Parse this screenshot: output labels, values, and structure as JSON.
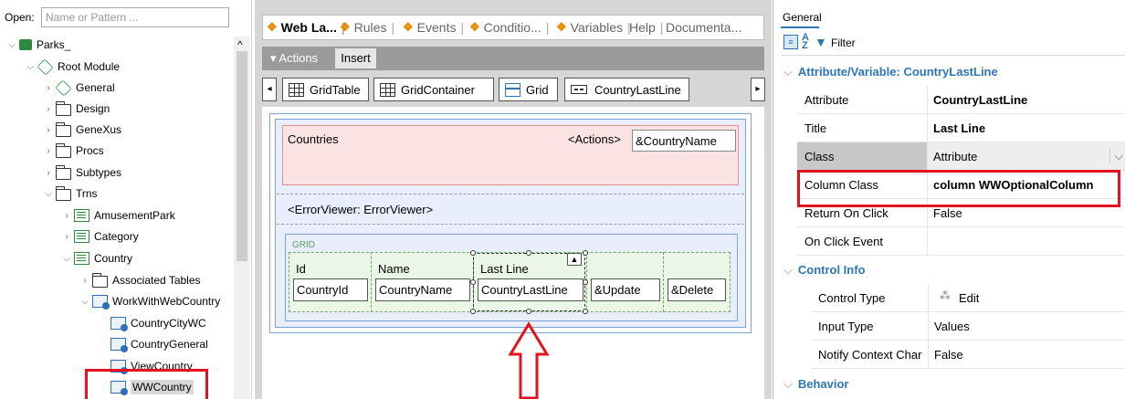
{
  "left_panel": {
    "open_label": "Open:",
    "open_placeholder": "Name or Pattern ...",
    "tree": [
      {
        "label": "Parks_",
        "icon": "kb-icon",
        "level": 0
      },
      {
        "label": "Root Module",
        "icon": "module-icon",
        "level": 1
      },
      {
        "label": "General",
        "icon": "module-icon",
        "level": 2
      },
      {
        "label": "Design",
        "icon": "folder-icon",
        "level": 2
      },
      {
        "label": "GeneXus",
        "icon": "folder-icon",
        "level": 2
      },
      {
        "label": "Procs",
        "icon": "folder-icon",
        "level": 2
      },
      {
        "label": "Subtypes",
        "icon": "folder-icon",
        "level": 2
      },
      {
        "label": "Trns",
        "icon": "folder-icon",
        "level": 2
      },
      {
        "label": "AmusementPark",
        "icon": "transaction-icon",
        "level": 3
      },
      {
        "label": "Category",
        "icon": "transaction-icon",
        "level": 3
      },
      {
        "label": "Country",
        "icon": "transaction-icon",
        "level": 3
      },
      {
        "label": "Associated Tables",
        "icon": "folder-icon",
        "level": 4
      },
      {
        "label": "WorkWithWebCountry",
        "icon": "workwith-icon",
        "level": 4
      },
      {
        "label": "CountryCityWC",
        "icon": "webcomponent-icon",
        "level": 5
      },
      {
        "label": "CountryGeneral",
        "icon": "webcomponent-icon",
        "level": 5
      },
      {
        "label": "ViewCountry",
        "icon": "webpanel-icon",
        "level": 5
      },
      {
        "label": "WWCountry",
        "icon": "webpanel-icon",
        "level": 5
      }
    ]
  },
  "editor": {
    "tabs": [
      "Web La...",
      "Rules",
      "Events",
      "Conditio...",
      "Variables",
      "Help",
      "Documenta..."
    ],
    "actions_label": "Actions",
    "insert_label": "Insert",
    "breadcrumbs": [
      "GridTable",
      "GridContainer",
      "Grid",
      "CountryLastLine"
    ],
    "form": {
      "countries_label": "Countries",
      "actions_placeholder": "<Actions>",
      "country_name_var": "&CountryName",
      "error_viewer": "<ErrorViewer: ErrorViewer>",
      "grid_label": "GRID",
      "grid_headers": [
        "Id",
        "Name",
        "Last Line",
        "",
        ""
      ],
      "grid_cells": [
        "CountryId",
        "CountryName",
        "CountryLastLine",
        "&Update",
        "&Delete"
      ]
    }
  },
  "properties": {
    "tab": "General",
    "filter_label": "Filter",
    "section_attribute": "Attribute/Variable: CountryLastLine",
    "rows_attribute": [
      {
        "key": "Attribute",
        "value": "CountryLastLine",
        "bold": true
      },
      {
        "key": "Title",
        "value": "Last Line",
        "bold": true
      },
      {
        "key": "Class",
        "value": "Attribute",
        "bold": false
      },
      {
        "key": "Column Class",
        "value": "column WWOptionalColumn",
        "bold": true
      },
      {
        "key": "Return On Click",
        "value": "False",
        "bold": false
      },
      {
        "key": "On Click Event",
        "value": "",
        "bold": false
      }
    ],
    "section_control": "Control Info",
    "rows_control": [
      {
        "key": "Control Type",
        "value": "Edit"
      },
      {
        "key": "Input Type",
        "value": "Values"
      },
      {
        "key": "Notify Context Char",
        "value": "False"
      }
    ],
    "section_behavior": "Behavior"
  },
  "colors": {
    "highlight": "#e3121e",
    "section_blue": "#2e75b6",
    "tab_orange": "#e68a00"
  }
}
